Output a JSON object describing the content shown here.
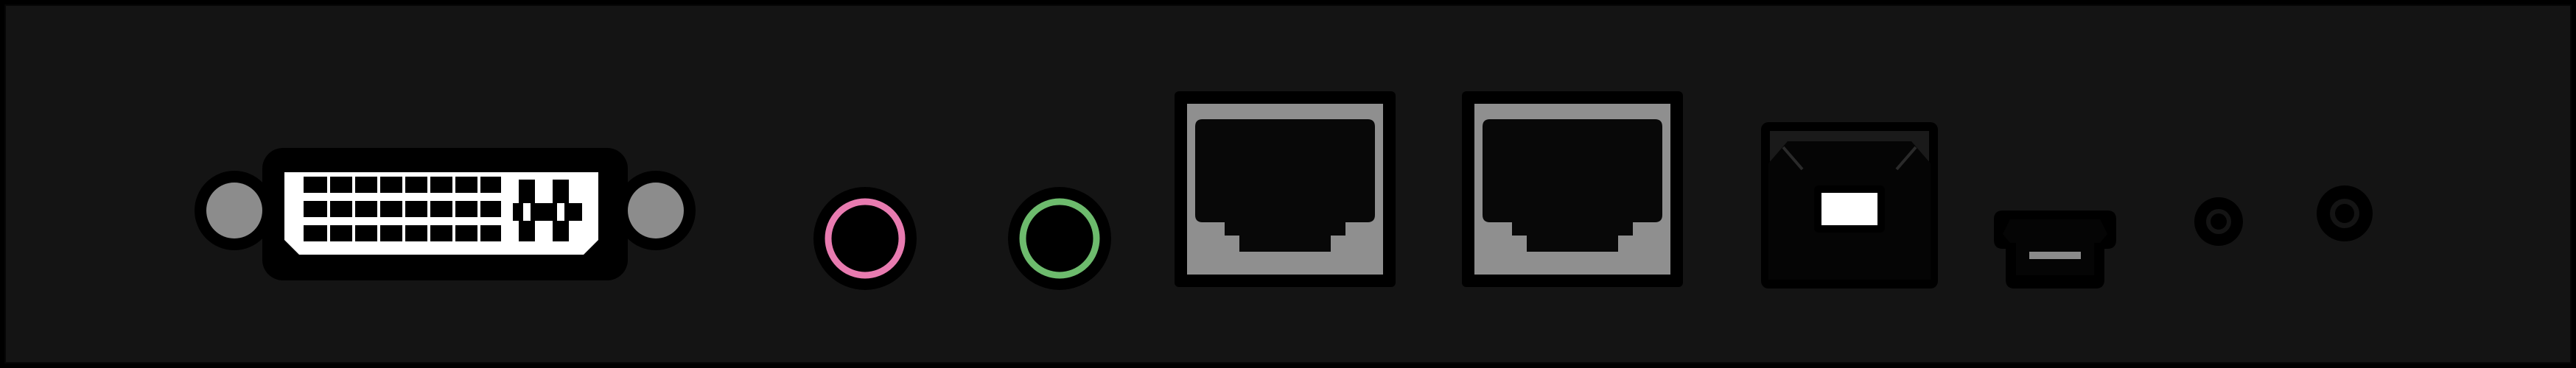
{
  "panel": {
    "background": "#141414",
    "frame": "#000000"
  },
  "ports": [
    {
      "id": "dvi-port",
      "icon": "dvi-connector-icon",
      "colors": {
        "shell": "#000000",
        "face": "#ffffff",
        "screw": "#8c8c8c"
      }
    },
    {
      "id": "audio-jack-pink",
      "icon": "audio-jack-icon",
      "ring_color": "#e87bb0"
    },
    {
      "id": "audio-jack-green",
      "icon": "audio-jack-icon",
      "ring_color": "#6dbb6d"
    },
    {
      "id": "ethernet-port-1",
      "icon": "rj45-icon",
      "colors": {
        "bezel": "#8f8f8f",
        "cavity": "#080808"
      }
    },
    {
      "id": "ethernet-port-2",
      "icon": "rj45-icon",
      "colors": {
        "bezel": "#8f8f8f",
        "cavity": "#080808"
      }
    },
    {
      "id": "usb-b-port",
      "icon": "usb-b-icon",
      "colors": {
        "housing": "#050505",
        "tongue": "#ffffff"
      }
    },
    {
      "id": "mini-usb-port",
      "icon": "mini-usb-icon",
      "colors": {
        "body": "#8a8a8a",
        "slot": "#050505"
      }
    },
    {
      "id": "led-hole-1",
      "icon": "indicator-hole-icon"
    },
    {
      "id": "led-hole-2",
      "icon": "indicator-hole-icon"
    }
  ]
}
